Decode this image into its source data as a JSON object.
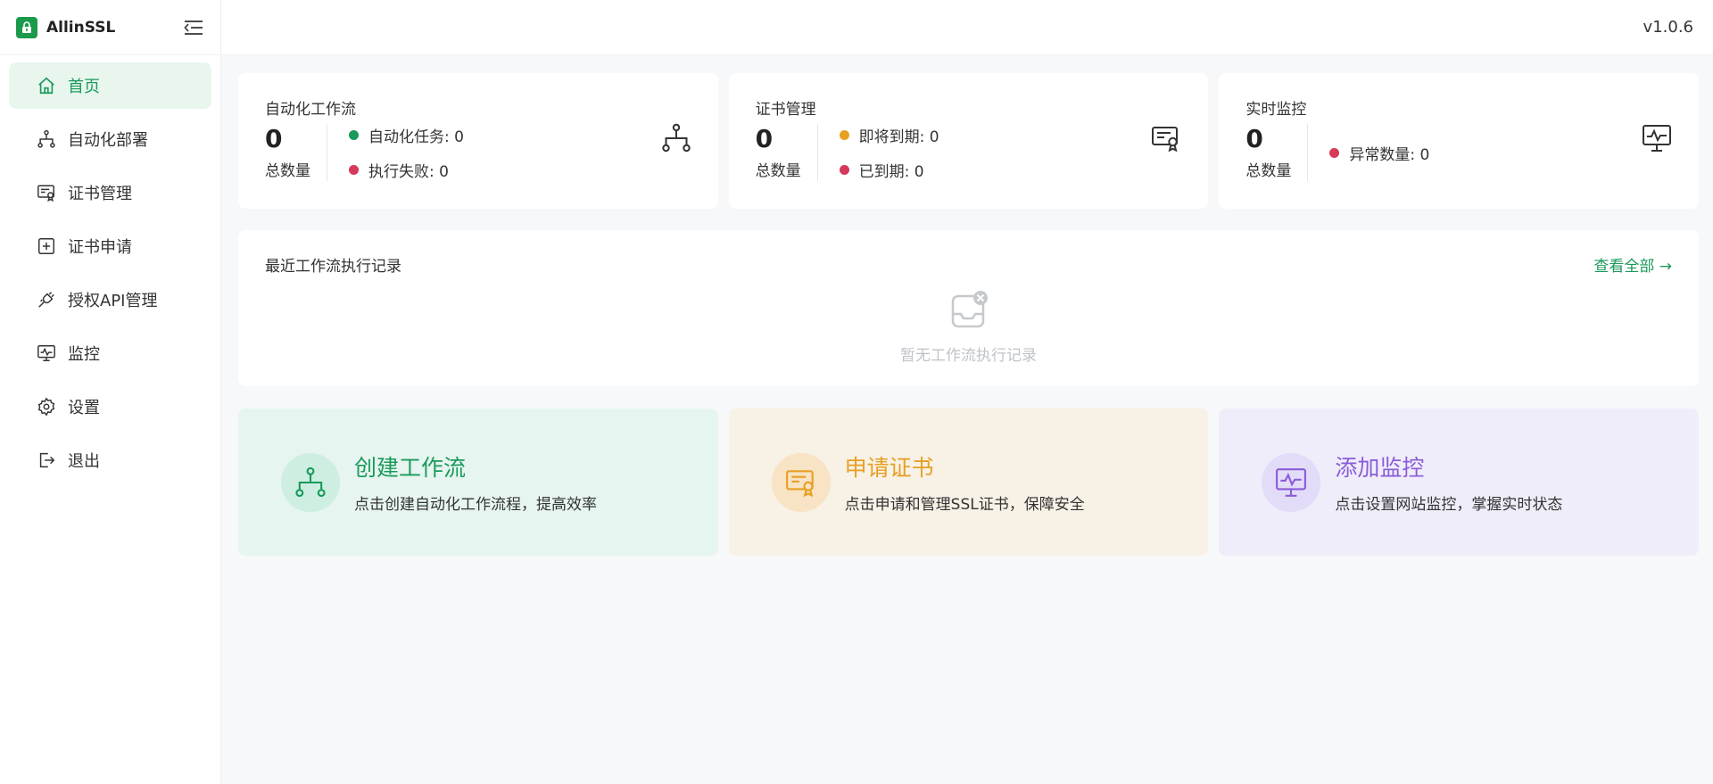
{
  "brand": {
    "name": "AllinSSL"
  },
  "topbar": {
    "version": "v1.0.6"
  },
  "sidebar": {
    "items": [
      {
        "label": "首页",
        "icon": "home-icon",
        "active": true
      },
      {
        "label": "自动化部署",
        "icon": "workflow-icon"
      },
      {
        "label": "证书管理",
        "icon": "certificate-icon"
      },
      {
        "label": "证书申请",
        "icon": "plus-square-icon"
      },
      {
        "label": "授权API管理",
        "icon": "api-plug-icon"
      },
      {
        "label": "监控",
        "icon": "monitor-icon"
      },
      {
        "label": "设置",
        "icon": "gear-icon"
      },
      {
        "label": "退出",
        "icon": "logout-icon"
      }
    ]
  },
  "stats": [
    {
      "title": "自动化工作流",
      "total": "0",
      "total_label": "总数量",
      "icon": "workflow-icon",
      "items": [
        {
          "label": "自动化任务: 0",
          "color": "#1a9a5c"
        },
        {
          "label": "执行失败: 0",
          "color": "#d6395a"
        }
      ]
    },
    {
      "title": "证书管理",
      "total": "0",
      "total_label": "总数量",
      "icon": "certificate-icon",
      "items": [
        {
          "label": "即将到期: 0",
          "color": "#e7a023"
        },
        {
          "label": "已到期: 0",
          "color": "#d6395a"
        }
      ]
    },
    {
      "title": "实时监控",
      "total": "0",
      "total_label": "总数量",
      "icon": "monitor-icon",
      "items": [
        {
          "label": "异常数量: 0",
          "color": "#d6395a"
        }
      ]
    }
  ],
  "records": {
    "title": "最近工作流执行记录",
    "view_all": "查看全部 →",
    "empty_text": "暂无工作流执行记录",
    "empty_icon": "empty-inbox-icon"
  },
  "actions": [
    {
      "title": "创建工作流",
      "desc": "点击创建自动化工作流程，提高效率",
      "bg": "#e6f5ef",
      "circle": "#cdeee0",
      "color": "#1a9a5c",
      "icon": "workflow-icon"
    },
    {
      "title": "申请证书",
      "desc": "点击申请和管理SSL证书，保障安全",
      "bg": "#f7f1e6",
      "circle": "#f8e3c4",
      "color": "#e7a023",
      "icon": "certificate-icon"
    },
    {
      "title": "添加监控",
      "desc": "点击设置网站监控，掌握实时状态",
      "bg": "#efedfa",
      "circle": "#e3dcf8",
      "color": "#8a5cd8",
      "icon": "monitor-icon"
    }
  ]
}
